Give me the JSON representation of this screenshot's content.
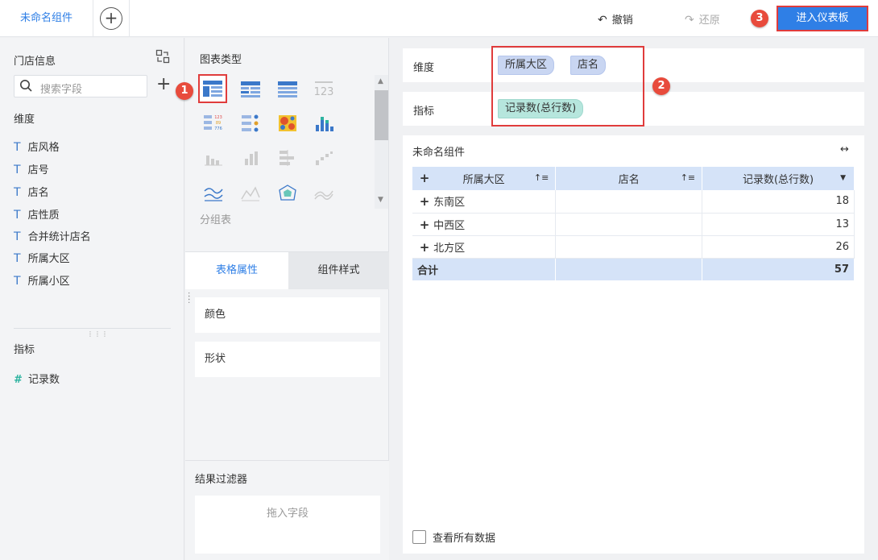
{
  "topbar": {
    "tab_label": "未命名组件",
    "add_tab": "+",
    "undo_label": "撤销",
    "redo_label": "还原",
    "enter_dashboard_label": "进入仪表板"
  },
  "badges": {
    "b1": "1",
    "b2": "2",
    "b3": "3"
  },
  "left_panel": {
    "dataset_title": "门店信息",
    "search_placeholder": "搜索字段",
    "dimension_label": "维度",
    "dimension_fields": [
      "店风格",
      "店号",
      "店名",
      "店性质",
      "合并统计店名",
      "所属大区",
      "所属小区"
    ],
    "metric_label": "指标",
    "metric_fields": [
      "记录数"
    ],
    "field_type_icon": "T",
    "metric_type_icon": "#"
  },
  "mid_panel": {
    "chart_type_title": "图表类型",
    "selected_type_caption": "分组表",
    "tabs": [
      "表格属性",
      "组件样式"
    ],
    "properties": [
      "颜色",
      "形状"
    ],
    "filter_title": "结果过滤器",
    "filter_placeholder": "拖入字段"
  },
  "right_panel": {
    "dimension_label": "维度",
    "dimension_pills": [
      "所属大区",
      "店名"
    ],
    "metric_label": "指标",
    "metric_pills": [
      "记录数(总行数)"
    ],
    "component_title": "未命名组件",
    "table": {
      "headers": [
        "所属大区",
        "店名",
        "记录数(总行数)"
      ],
      "rows": [
        {
          "region": "东南区",
          "count": "18"
        },
        {
          "region": "中西区",
          "count": "13"
        },
        {
          "region": "北方区",
          "count": "26"
        }
      ],
      "total_label": "合计",
      "total_value": "57"
    },
    "view_all_label": "查看所有数据"
  },
  "colors": {
    "accent": "#2f7fe6",
    "annotation_red": "#e03c3c",
    "header_blue": "#d5e3f8",
    "dimension_pill": "#c9d6f2",
    "metric_pill": "#b6e6dd"
  }
}
